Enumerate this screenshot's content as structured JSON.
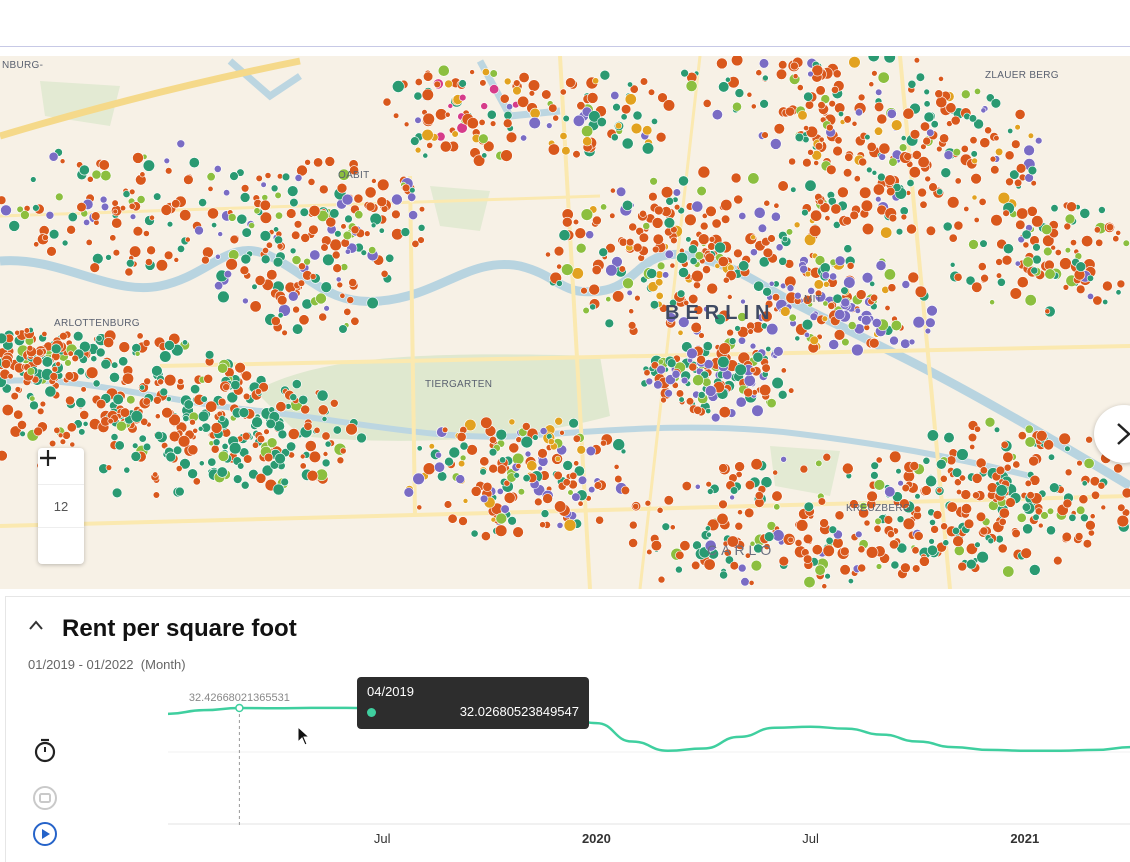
{
  "map": {
    "labels": {
      "nburg": "NBURG-",
      "zlauer_berg": "ZLAUER BERG",
      "charlottenburg": "ARLOTTENBURG",
      "tiergarten": "TIERGARTEN",
      "berlin": "BERLIN",
      "kreuzberg": "KREUZBERG",
      "carlo": "CARLO",
      "mitte": "MIT",
      "moabit": "OABIT"
    },
    "zoom": {
      "in_icon": "plus-icon",
      "out_icon": "minus-icon",
      "level": "12"
    },
    "next_icon": "chevron-right-icon",
    "dot_colors": [
      "#d9581c",
      "#2a9a72",
      "#7a6cc4",
      "#8cbf3f",
      "#e2a21f",
      "#d63c8a"
    ]
  },
  "panel": {
    "collapse_icon": "chevron-up-icon",
    "title": "Rent per square foot",
    "range": "01/2019 - 01/2022",
    "granularity": "(Month)"
  },
  "controls": {
    "timer_icon": "stopwatch-icon",
    "stop_icon": "stop-icon",
    "play_icon": "play-icon"
  },
  "tooltip": {
    "date": "04/2019",
    "value": "32.02680523849547"
  },
  "chart_data": {
    "type": "line",
    "x_ticks": [
      "Jul",
      "2020",
      "Jul",
      "2021"
    ],
    "hover_label": "32.42668021365531",
    "series": [
      {
        "color": "#3fcf9f",
        "points": [
          {
            "x": "2019-01",
            "y": 32.3
          },
          {
            "x": "2019-02",
            "y": 32.38
          },
          {
            "x": "2019-03",
            "y": 32.4267
          },
          {
            "x": "2019-04",
            "y": 32.42
          },
          {
            "x": "2019-05",
            "y": 32.43
          },
          {
            "x": "2019-06",
            "y": 32.43
          },
          {
            "x": "2019-07",
            "y": 32.42
          },
          {
            "x": "2019-08",
            "y": 32.41
          },
          {
            "x": "2019-09",
            "y": 32.4
          },
          {
            "x": "2019-10",
            "y": 32.38
          },
          {
            "x": "2019-11",
            "y": 32.34
          },
          {
            "x": "2019-12",
            "y": 32.28
          },
          {
            "x": "2020-01",
            "y": 32.1
          },
          {
            "x": "2020-02",
            "y": 31.7
          },
          {
            "x": "2020-03",
            "y": 31.5
          },
          {
            "x": "2020-04",
            "y": 31.55
          },
          {
            "x": "2020-05",
            "y": 31.8
          },
          {
            "x": "2020-06",
            "y": 32.0
          },
          {
            "x": "2020-07",
            "y": 32.02
          },
          {
            "x": "2020-08",
            "y": 31.98
          },
          {
            "x": "2020-09",
            "y": 31.85
          },
          {
            "x": "2020-10",
            "y": 31.7
          },
          {
            "x": "2020-11",
            "y": 31.58
          },
          {
            "x": "2020-12",
            "y": 31.52
          },
          {
            "x": "2021-01",
            "y": 31.5
          },
          {
            "x": "2021-02",
            "y": 31.5
          },
          {
            "x": "2021-03",
            "y": 31.52
          },
          {
            "x": "2021-04",
            "y": 31.58
          },
          {
            "x": "2021-05",
            "y": 31.66
          },
          {
            "x": "2021-06",
            "y": 31.74
          }
        ]
      }
    ],
    "hover": {
      "x": "2019-03"
    }
  }
}
